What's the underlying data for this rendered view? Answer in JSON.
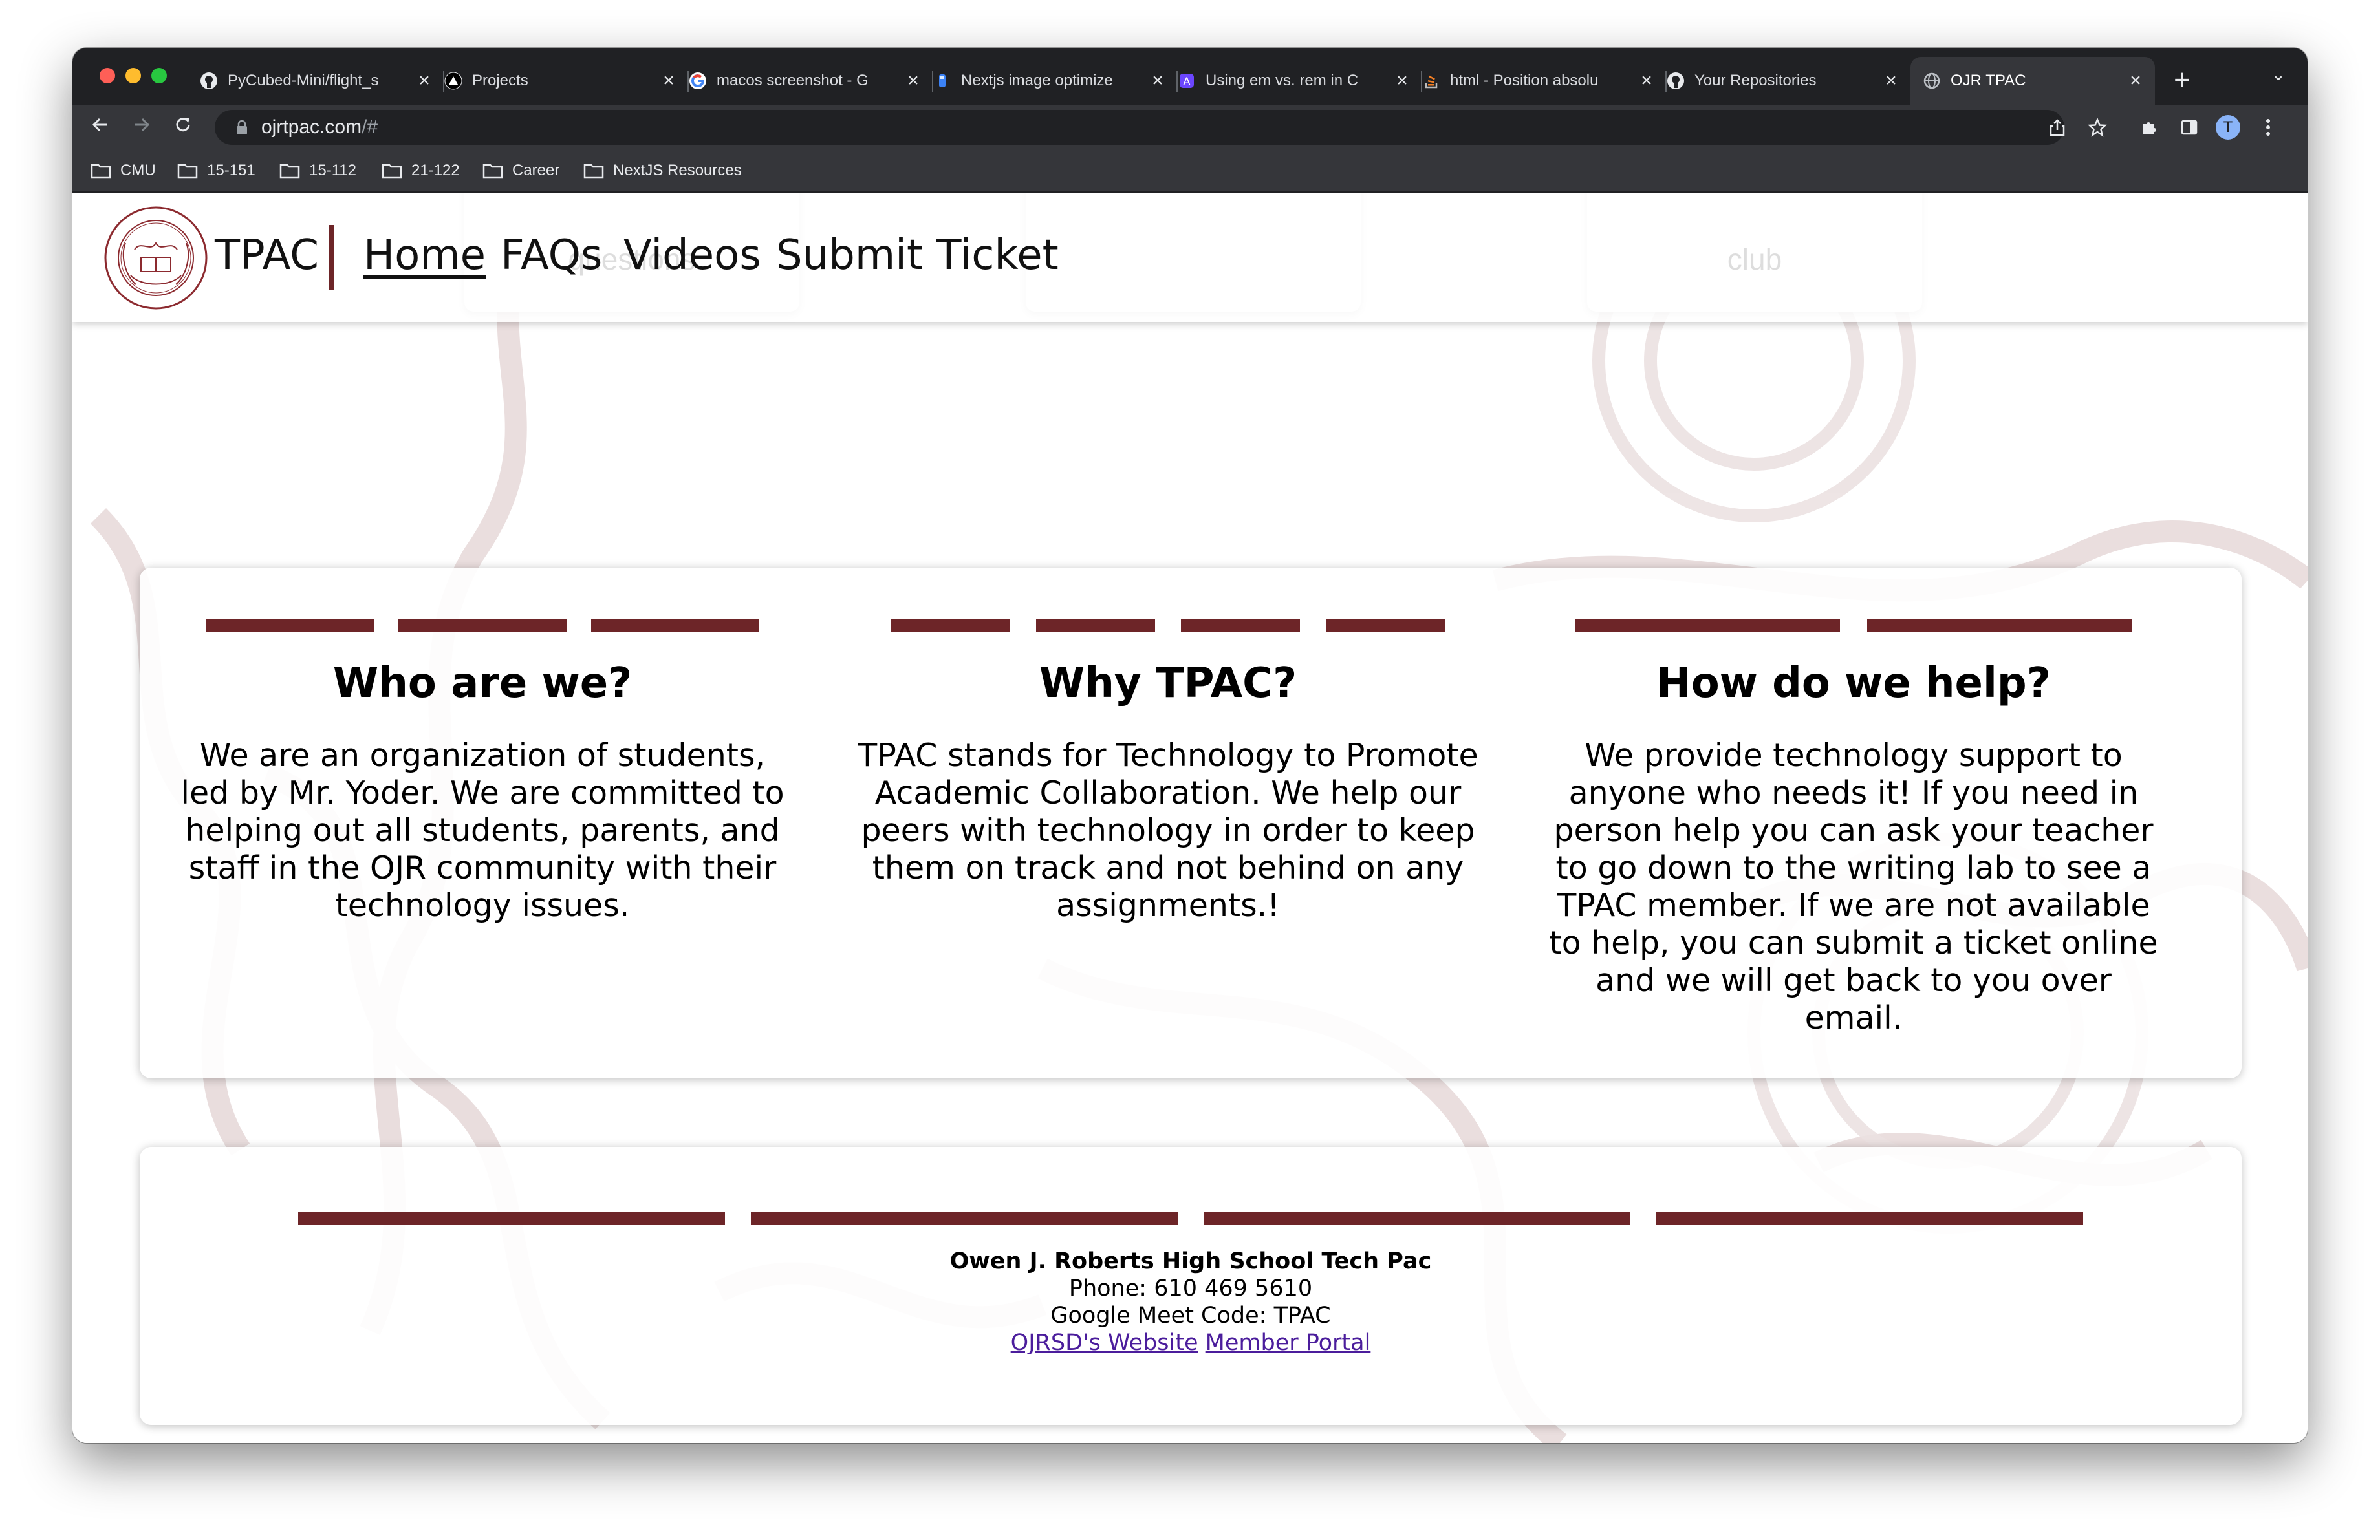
{
  "browser": {
    "tabs": [
      {
        "title": "PyCubed-Mini/flight_s",
        "icon": "github-icon"
      },
      {
        "title": "Projects",
        "icon": "vercel-icon"
      },
      {
        "title": "macos screenshot - G",
        "icon": "google-icon"
      },
      {
        "title": "Nextjs image optimize",
        "icon": "file-icon"
      },
      {
        "title": "Using em vs. rem in C",
        "icon": "a-logo-icon"
      },
      {
        "title": "html - Position absolu",
        "icon": "stackoverflow-icon"
      },
      {
        "title": "Your Repositories",
        "icon": "github-icon"
      },
      {
        "title": "OJR TPAC",
        "icon": "globe-icon",
        "active": true
      }
    ],
    "close_glyph": "×",
    "new_tab_glyph": "+",
    "tab_menu_glyph": "⌄",
    "url_host": "ojrtpac.com",
    "url_path": "/#",
    "profile_initial": "T",
    "bookmarks": [
      "CMU",
      "15-151",
      "15-112",
      "21-122",
      "Career",
      "NextJS Resources"
    ]
  },
  "site": {
    "brand": "TPAC",
    "nav": [
      {
        "label": "Home",
        "active": true
      },
      {
        "label": "FAQs"
      },
      {
        "label": "Videos"
      },
      {
        "label": "Submit Ticket"
      }
    ],
    "feature_cards": [
      {
        "label": "questions"
      },
      {
        "label": ""
      },
      {
        "label": "club"
      }
    ],
    "sections": [
      {
        "heading": "Who are we?",
        "body": "We are an organization of students, led by Mr. Yoder. We are committed to helping out all students, parents, and staff in the OJR community with their technology issues."
      },
      {
        "heading": "Why TPAC?",
        "body": "TPAC stands for Technology to Promote Academic Collaboration. We help our peers with technology in order to keep them on track and not behind on any assignments.!"
      },
      {
        "heading": "How do we help?",
        "body": "We provide technology support to anyone who needs it! If you need in person help you can ask your teacher to go down to the writing lab to see a TPAC member. If we are not available to help, you can submit a ticket online and we will get back to you over email."
      }
    ],
    "footer": {
      "name": "Owen J. Roberts High School Tech Pac",
      "phone": "Phone: 610 469 5610",
      "meet": "Google Meet Code: TPAC",
      "links": [
        "OJRSD's Website",
        "Member Portal"
      ]
    },
    "colors": {
      "accent": "#6d2528",
      "link": "#4b1d9c"
    }
  }
}
